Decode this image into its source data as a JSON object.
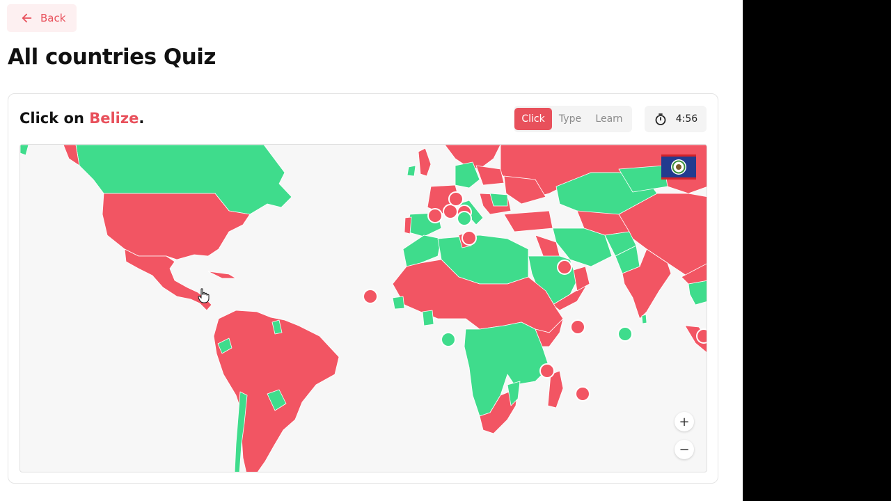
{
  "header": {
    "back_label": "Back",
    "title": "All countries Quiz"
  },
  "quiz": {
    "prompt_prefix": "Click on ",
    "target_country": "Belize",
    "prompt_suffix": ".",
    "modes": [
      {
        "label": "Click",
        "active": true
      },
      {
        "label": "Type",
        "active": false
      },
      {
        "label": "Learn",
        "active": false
      }
    ],
    "timer": "4:56"
  },
  "map": {
    "colors": {
      "correct": "#3fdc8c",
      "wrong": "#f25563",
      "ocean": "#f7f7f7",
      "border": "#ffffff"
    },
    "zoom_in_label": "+",
    "zoom_out_label": "−",
    "flag_icon": "belize-flag"
  }
}
